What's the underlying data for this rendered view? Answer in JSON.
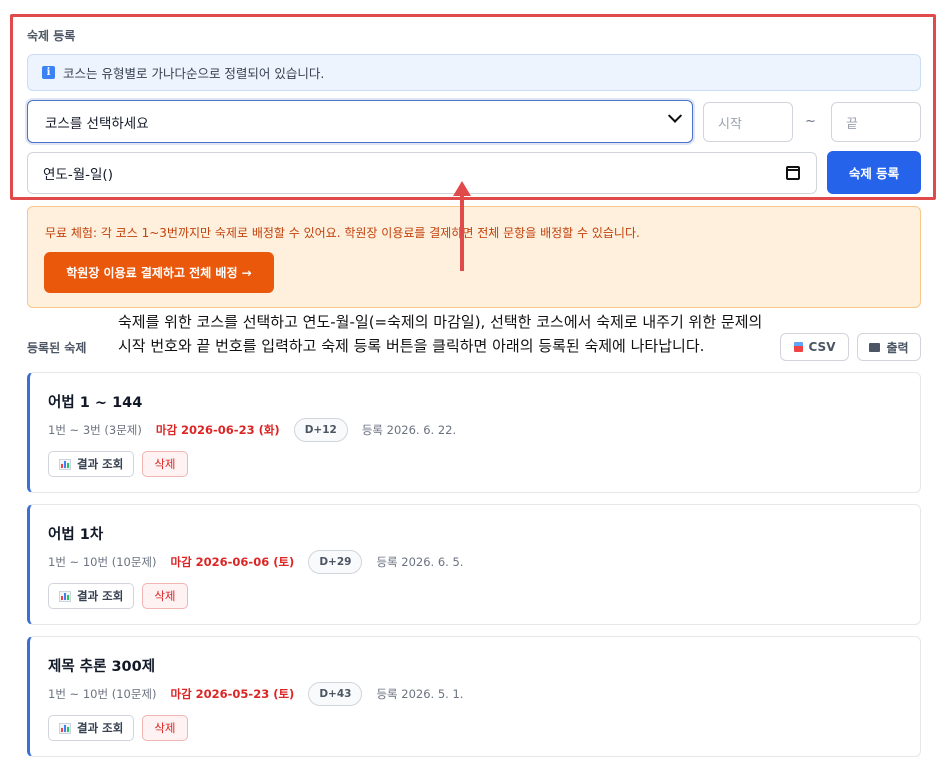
{
  "registration": {
    "section_label": "숙제 등록",
    "info_text": "코스는 유형별로 가나다순으로 정렬되어 있습니다.",
    "course_select_value": "코스를 선택하세요",
    "start_placeholder": "시작",
    "range_separator": "~",
    "end_placeholder": "끝",
    "date_value": "연도-월-일()",
    "submit_label": "숙제 등록"
  },
  "trial": {
    "text": "무료 체험: 각 코스 1~3번까지만 숙제로 배정할 수 있어요. 학원장 이용료를 결제하면 전체 문항을 배정할 수 있습니다.",
    "button_label": "학원장 이용료 결제하고 전체 배정 →"
  },
  "annotation": {
    "line1": "숙제를 위한 코스를 선택하고 연도-월-일(=숙제의 마감일), 선택한 코스에서 숙제로 내주기 위한 문제의",
    "line2": "시작 번호와 끝 번호를 입력하고 숙제 등록 버튼을 클릭하면 아래의 등록된 숙제에 나타납니다."
  },
  "list": {
    "section_label": "등록된 숙제",
    "csv_label": "CSV",
    "print_label": "출력",
    "items": [
      {
        "title": "어법 1 ~ 144",
        "range": "1번 ~ 3번 (3문제)",
        "deadline": "마감 2026-06-23 (화)",
        "dday": "D+12",
        "registered": "등록 2026. 6. 22.",
        "result_label": "결과 조회",
        "delete_label": "삭제"
      },
      {
        "title": "어법 1차",
        "range": "1번 ~ 10번 (10문제)",
        "deadline": "마감 2026-06-06 (토)",
        "dday": "D+29",
        "registered": "등록 2026. 6. 5.",
        "result_label": "결과 조회",
        "delete_label": "삭제"
      },
      {
        "title": "제목 추론 300제",
        "range": "1번 ~ 10번 (10문제)",
        "deadline": "마감 2026-05-23 (토)",
        "dday": "D+43",
        "registered": "등록 2026. 5. 1.",
        "result_label": "결과 조회",
        "delete_label": "삭제"
      }
    ]
  },
  "colors": {
    "primary": "#2563eb",
    "accent_orange": "#ea580c",
    "deadline_red": "#dc2626",
    "highlight_border": "#e04a4a"
  },
  "icons": [
    "info-icon",
    "chevron-down-icon",
    "calendar-icon",
    "download-icon",
    "printer-icon",
    "bar-chart-icon",
    "up-arrow-icon"
  ]
}
